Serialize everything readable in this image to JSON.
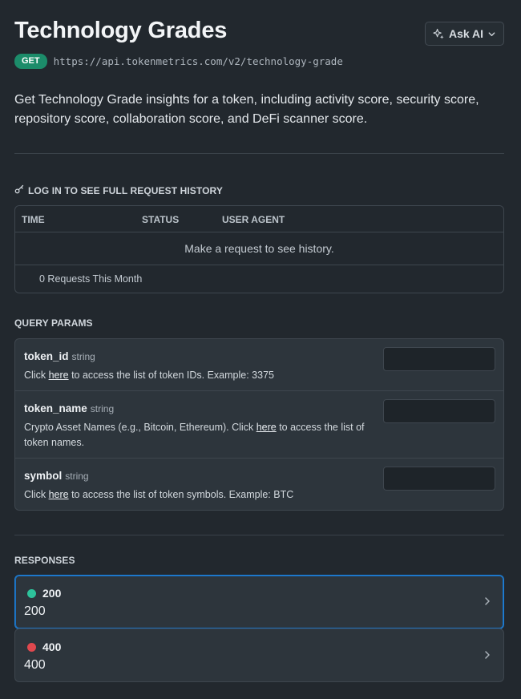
{
  "page": {
    "title": "Technology Grades",
    "ask_ai_label": "Ask AI",
    "method": "GET",
    "endpoint": "https://api.tokenmetrics.com/v2/technology-grade",
    "description": "Get Technology Grade insights for a token, including activity score, security score, repository score, collaboration score, and DeFi scanner score."
  },
  "history": {
    "label": "LOG IN TO SEE FULL REQUEST HISTORY",
    "columns": [
      "TIME",
      "STATUS",
      "USER AGENT"
    ],
    "empty_message": "Make a request to see history.",
    "count_label": "0 Requests This Month"
  },
  "query_params": {
    "label": "QUERY PARAMS",
    "params": [
      {
        "name": "token_id",
        "type": "string",
        "desc_pre": "Click ",
        "link": "here",
        "desc_post": " to access the list of token IDs. Example: 3375",
        "value": ""
      },
      {
        "name": "token_name",
        "type": "string",
        "desc_pre": "Crypto Asset Names (e.g., Bitcoin, Ethereum). Click ",
        "link": "here",
        "desc_post": " to access the list of token names.",
        "value": ""
      },
      {
        "name": "symbol",
        "type": "string",
        "desc_pre": "Click ",
        "link": "here",
        "desc_post": " to access the list of token symbols. Example: BTC",
        "value": ""
      }
    ]
  },
  "responses": {
    "label": "RESPONSES",
    "items": [
      {
        "code": "200",
        "description": "200",
        "dot_color": "#2dc29b"
      },
      {
        "code": "400",
        "description": "400",
        "dot_color": "#e0484e"
      }
    ]
  },
  "icons": {
    "ask_ai": "sparkles-icon",
    "ask_ai_caret": "chevron-down-icon",
    "history": "key-icon",
    "response_arrow": "chevron-right-icon"
  },
  "colors": {
    "background": "#22282e",
    "card": "#2d353c",
    "method_badge": "#1c8c6a",
    "active_border": "#1f7fd6"
  }
}
